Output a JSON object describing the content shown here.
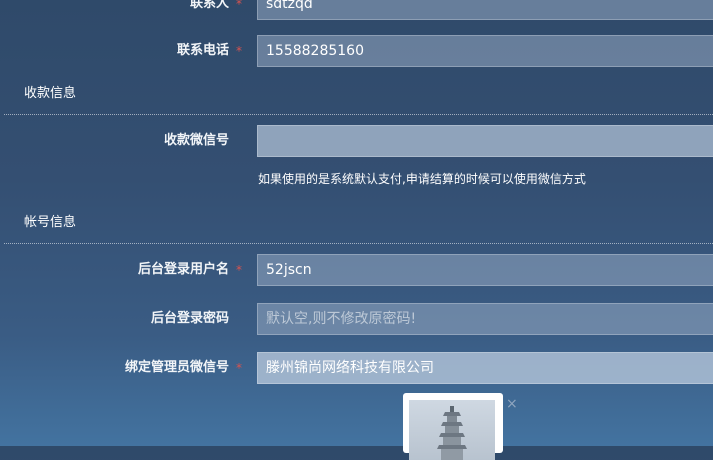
{
  "contact": {
    "person_label": "联系人",
    "person_value": "sdtzqd",
    "phone_label": "联系电话",
    "phone_value": "15588285160",
    "required_mark": "*"
  },
  "payment_section": {
    "title": "收款信息",
    "wechat_label": "收款微信号",
    "wechat_value": "",
    "hint": "如果使用的是系统默认支付,申请结算的时候可以使用微信方式"
  },
  "account_section": {
    "title": "帐号信息",
    "username_label": "后台登录用户名",
    "username_value": "52jscn",
    "password_label": "后台登录密码",
    "password_placeholder": "默认空,则不修改原密码!",
    "admin_wechat_label": "绑定管理员微信号",
    "admin_wechat_value": "滕州锦尚网络科技有限公司"
  },
  "image_preview": {
    "close_glyph": "×",
    "icon": "pagoda-image"
  },
  "colors": {
    "required": "#d9534f",
    "background_top": "#2f4a6a",
    "background_bottom": "#4373a0"
  }
}
